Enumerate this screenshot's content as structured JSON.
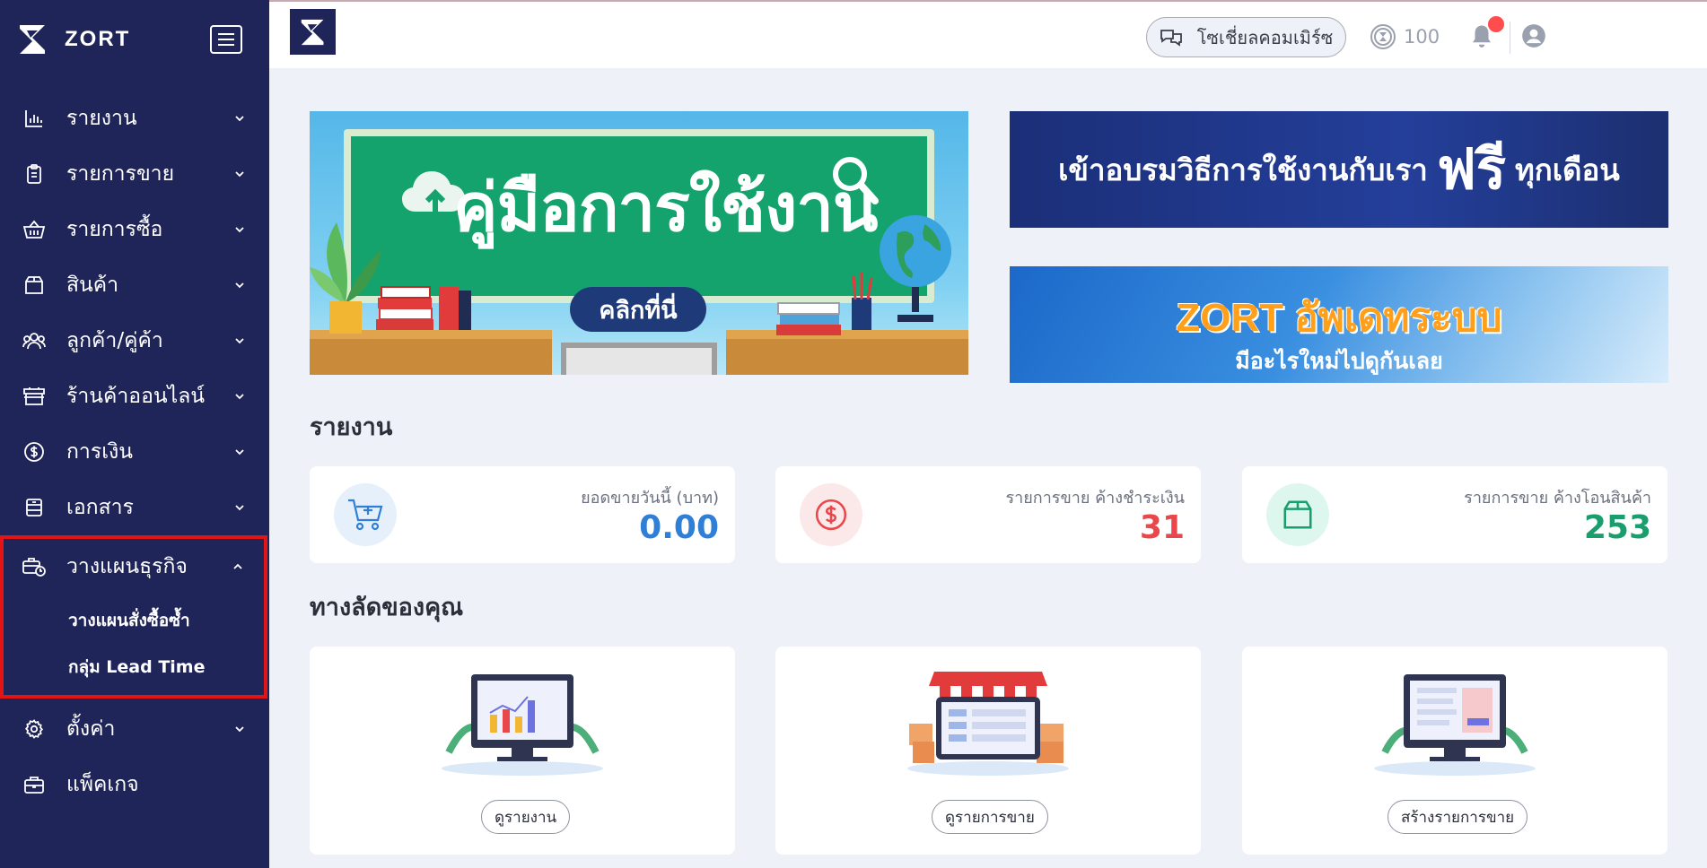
{
  "brand": {
    "name": "ZORT"
  },
  "sidebar": {
    "items": [
      {
        "label": "รายงาน",
        "icon": "bar-chart-icon"
      },
      {
        "label": "รายการขาย",
        "icon": "clipboard-icon"
      },
      {
        "label": "รายการซื้อ",
        "icon": "basket-icon"
      },
      {
        "label": "สินค้า",
        "icon": "box-icon"
      },
      {
        "label": "ลูกค้า/คู่ค้า",
        "icon": "users-icon"
      },
      {
        "label": "ร้านค้าออนไลน์",
        "icon": "store-icon"
      },
      {
        "label": "การเงิน",
        "icon": "dollar-circle-icon"
      },
      {
        "label": "เอกสาร",
        "icon": "document-icon"
      }
    ],
    "expanded_group": {
      "label": "วางแผนธุรกิจ",
      "icon": "briefcase-clock-icon",
      "highlight_color": "#e51414",
      "subitems": [
        "วางแผนสั่งซื้อซ้ำ",
        "กลุ่ม Lead Time"
      ]
    },
    "bottom_items": [
      {
        "label": "ตั้งค่า",
        "icon": "gear-icon"
      },
      {
        "label": "แพ็คเกจ",
        "icon": "briefcase-icon"
      }
    ]
  },
  "topbar": {
    "social_commerce_label": "โซเชี่ยลคอมเมิร์ซ",
    "credits": "100"
  },
  "banners": {
    "manual": {
      "title": "คู่มือการใช้งาน",
      "cta": "คลิกที่นี่"
    },
    "training": {
      "text_before": "เข้าอบรมวิธีการใช้งานกับเรา",
      "free": "ฟรี",
      "text_after": "ทุกเดือน"
    },
    "update": {
      "title": "ZORT อัพเดทระบบ",
      "subtitle": "มีอะไรใหม่ไปดูกันเลย"
    }
  },
  "reports": {
    "title": "รายงาน",
    "cards": [
      {
        "label": "ยอดขายวันนี้ (บาท)",
        "value": "0.00",
        "color": "#2f7fd6",
        "icon": "cart-plus-icon"
      },
      {
        "label": "รายการขาย ค้างชำระเงิน",
        "value": "31",
        "color": "#e8474c",
        "icon": "dollar-circle-icon"
      },
      {
        "label": "รายการขาย ค้างโอนสินค้า",
        "value": "253",
        "color": "#1a9e6e",
        "icon": "box-icon"
      }
    ]
  },
  "shortcuts": {
    "title": "ทางลัดของคุณ",
    "cards": [
      {
        "button": "ดูรายงาน"
      },
      {
        "button": "ดูรายการขาย"
      },
      {
        "button": "สร้างรายการขาย"
      }
    ]
  }
}
